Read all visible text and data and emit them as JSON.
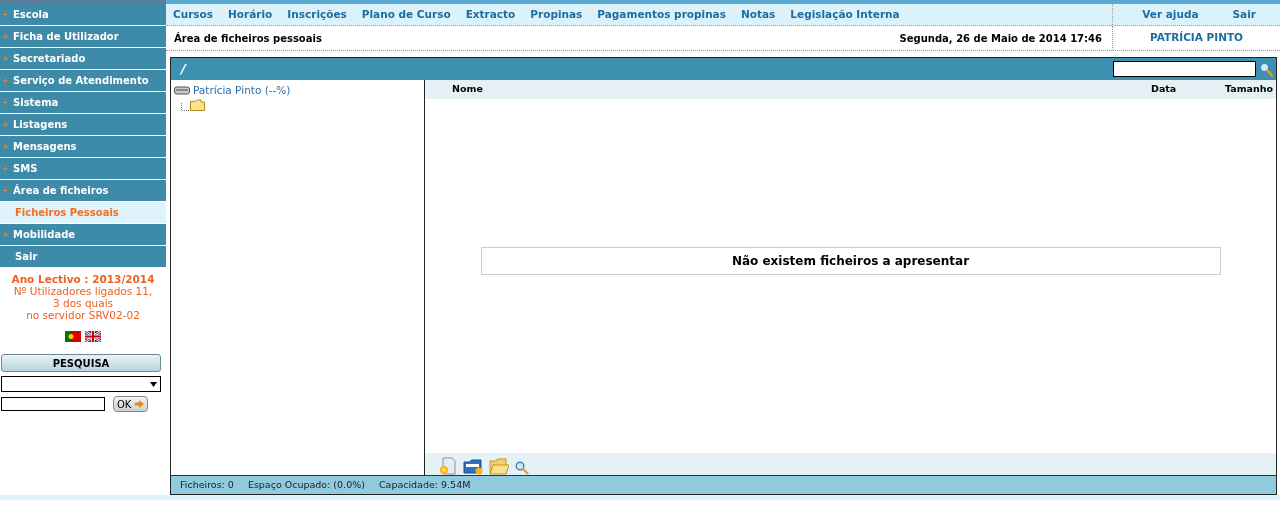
{
  "sidebar": {
    "items": [
      {
        "label": "Escola",
        "kind": "section",
        "selected": false
      },
      {
        "label": "Ficha de Utilizador",
        "kind": "section",
        "selected": false
      },
      {
        "label": "Secretariado",
        "kind": "section",
        "selected": false
      },
      {
        "label": "Serviço de Atendimento",
        "kind": "section",
        "selected": false
      },
      {
        "label": "Sistema",
        "kind": "section",
        "selected": false
      },
      {
        "label": "Listagens",
        "kind": "section",
        "selected": false
      },
      {
        "label": "Mensagens",
        "kind": "section",
        "selected": false
      },
      {
        "label": "SMS",
        "kind": "section",
        "selected": false
      },
      {
        "label": "Área de ficheiros",
        "kind": "section",
        "selected": false
      },
      {
        "label": "Ficheiros Pessoais",
        "kind": "subitem",
        "selected": true
      },
      {
        "label": "Mobilidade",
        "kind": "section",
        "selected": false
      },
      {
        "label": "Sair",
        "kind": "link",
        "selected": false
      }
    ],
    "info": {
      "year": "Ano Lectivo : 2013/2014",
      "lines": [
        "Nº Utilizadores ligados 11,",
        "3 dos quais",
        "no servidor SRV02-02"
      ]
    },
    "search": {
      "button": "PESQUISA",
      "ok": "OK"
    }
  },
  "top_nav": {
    "links": [
      "Cursos",
      "Horário",
      "Inscrições",
      "Plano de Curso",
      "Extracto",
      "Propinas",
      "Pagamentos propinas",
      "Notas",
      "Legislação Interna"
    ],
    "right_links": [
      "Ver ajuda",
      "Sair"
    ]
  },
  "header": {
    "title": "Área de ficheiros pessoais",
    "date": "Segunda, 26 de Maio de 2014 17:46",
    "user": "PATRÍCIA PINTO"
  },
  "file_panel": {
    "path": "/",
    "tree": {
      "label": "Patrícia Pinto (--%)",
      "children": [
        {
          "kind": "folder"
        }
      ]
    },
    "columns": [
      "Nome",
      "Data",
      "Tamanho"
    ],
    "empty_message": "Não existem ficheiros a apresentar",
    "status": [
      "Ficheiros: 0",
      "Espaço Ocupado: (0.0%)",
      "Capacidade: 9.54M"
    ]
  }
}
